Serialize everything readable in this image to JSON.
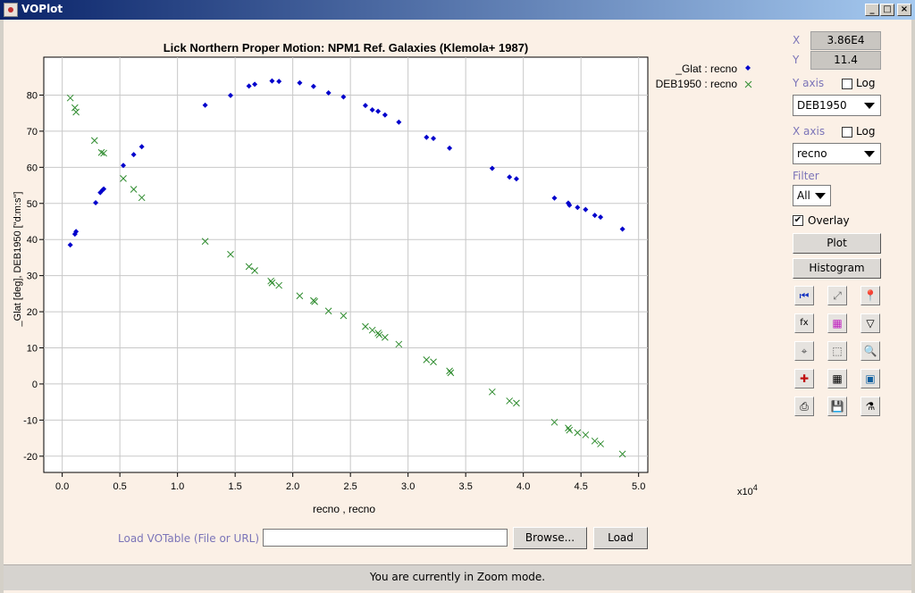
{
  "window": {
    "title": "VOPlot"
  },
  "chart_data": {
    "type": "scatter",
    "title": "Lick Northern Proper Motion: NPM1 Ref. Galaxies (Klemola+ 1987)",
    "xlabel": "recno , recno",
    "ylabel": "_Glat [deg], DEB1950 [\"d:m:s\"]",
    "x_multiplier": "x10",
    "x_multiplier_exp": "4",
    "xlim": [
      -0.16,
      5.08
    ],
    "ylim": [
      -24.5,
      90.5
    ],
    "grid": true,
    "legend_position": "top-right",
    "xticks": [
      "0.0",
      "0.5",
      "1.0",
      "1.5",
      "2.0",
      "2.5",
      "3.0",
      "3.5",
      "4.0",
      "4.5",
      "5.0"
    ],
    "yticks": [
      "80",
      "70",
      "60",
      "50",
      "40",
      "30",
      "20",
      "10",
      "0",
      "-10",
      "-20"
    ],
    "series": [
      {
        "name": "_Glat : recno",
        "marker": "diamond",
        "color": "#0000cc",
        "x": [
          0.07,
          0.11,
          0.12,
          0.33,
          0.35,
          0.36,
          0.29,
          0.53,
          0.62,
          0.69,
          1.24,
          1.46,
          1.62,
          1.67,
          1.82,
          1.88,
          2.06,
          2.18,
          2.31,
          2.44,
          2.63,
          2.69,
          2.74,
          2.8,
          2.92,
          3.16,
          3.22,
          3.36,
          3.73,
          3.88,
          3.94,
          4.27,
          4.39,
          4.4,
          4.47,
          4.54,
          4.62,
          4.67,
          4.86
        ],
        "y": [
          38.5,
          41.5,
          42.2,
          53.0,
          53.7,
          54.0,
          50.2,
          60.5,
          63.5,
          65.7,
          77.2,
          79.9,
          82.5,
          83.0,
          83.9,
          83.8,
          83.4,
          82.4,
          80.6,
          79.5,
          77.1,
          75.9,
          75.5,
          74.5,
          72.5,
          68.3,
          68.0,
          65.3,
          59.7,
          57.3,
          56.8,
          51.5,
          50.1,
          49.5,
          48.9,
          48.3,
          46.7,
          46.2,
          42.9
        ]
      },
      {
        "name": "DEB1950 : recno",
        "marker": "x",
        "color": "#2e8b2e",
        "x": [
          0.07,
          0.11,
          0.12,
          0.28,
          0.34,
          0.36,
          0.53,
          0.62,
          0.69,
          1.24,
          1.46,
          1.62,
          1.67,
          1.81,
          1.82,
          1.88,
          2.06,
          2.18,
          2.19,
          2.31,
          2.44,
          2.63,
          2.69,
          2.74,
          2.75,
          2.8,
          2.92,
          3.16,
          3.22,
          3.36,
          3.37,
          3.73,
          3.88,
          3.94,
          4.27,
          4.39,
          4.4,
          4.47,
          4.54,
          4.62,
          4.67,
          4.86
        ],
        "y": [
          79.2,
          76.5,
          75.3,
          67.4,
          64.1,
          63.9,
          56.9,
          53.9,
          51.6,
          39.5,
          35.9,
          32.5,
          31.4,
          28.5,
          28.0,
          27.3,
          24.4,
          23.1,
          22.8,
          20.2,
          18.9,
          15.9,
          14.9,
          14.1,
          13.6,
          12.9,
          11.0,
          6.7,
          6.1,
          3.6,
          3.1,
          -2.2,
          -4.7,
          -5.3,
          -10.6,
          -12.2,
          -12.8,
          -13.5,
          -14.1,
          -15.8,
          -16.6,
          -19.4
        ]
      }
    ]
  },
  "side_panel": {
    "x_label": "X",
    "x_value": "3.86E4",
    "y_label": "Y",
    "y_value": "11.4",
    "y_axis_label": "Y axis",
    "y_log_label": "Log",
    "y_axis_selected": "DEB1950",
    "x_axis_label": "X axis",
    "x_log_label": "Log",
    "x_axis_selected": "recno",
    "filter_label": "Filter",
    "filter_selected": "All",
    "overlay_label": "Overlay",
    "overlay_checked": true,
    "plot_button": "Plot",
    "histogram_button": "Histogram",
    "fx_label": "fx"
  },
  "load_bar": {
    "label": "Load VOTable (File or URL) :",
    "input_value": "",
    "browse_button": "Browse...",
    "load_button": "Load"
  },
  "status_bar": {
    "text": "You are currently in Zoom mode."
  }
}
